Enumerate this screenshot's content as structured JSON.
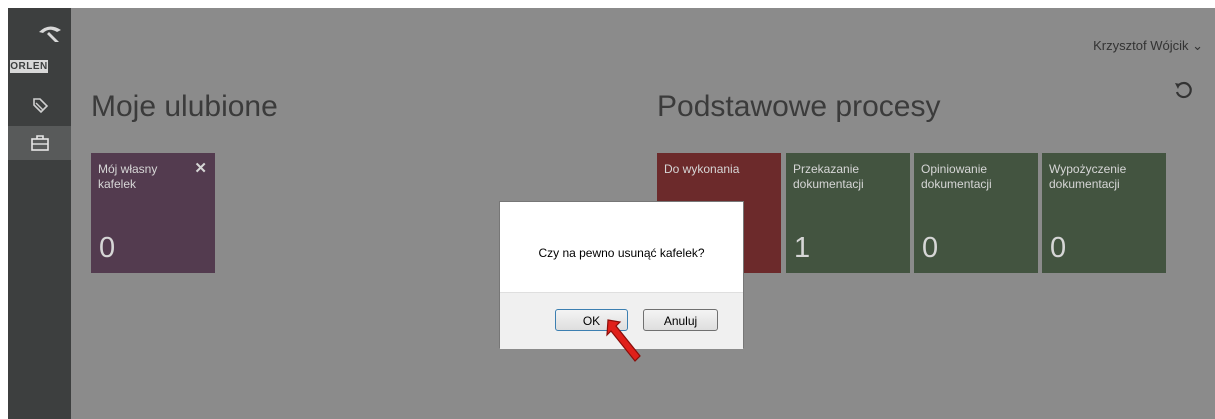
{
  "sidebar": {
    "logo_text": "ORLEN",
    "items": [
      {
        "name": "documents",
        "icon": "tag-icon"
      },
      {
        "name": "processes",
        "icon": "briefcase-icon"
      }
    ]
  },
  "header": {
    "user_name": "Krzysztof Wójcik",
    "user_chevron": "⌄",
    "refresh_icon": "refresh-icon"
  },
  "favorites": {
    "title": "Moje ulubione",
    "tiles": [
      {
        "label": "Mój własny kafelek",
        "count": "0",
        "color": "#533b4f",
        "close": "✕"
      }
    ]
  },
  "processes": {
    "title": "Podstawowe procesy",
    "tiles": [
      {
        "label": "Do wykonania",
        "count": "",
        "color": "#6c2a2b"
      },
      {
        "label": "Przekazanie dokumentacji",
        "count": "1",
        "color": "#435440"
      },
      {
        "label": "Opiniowanie dokumentacji",
        "count": "0",
        "color": "#435440"
      },
      {
        "label": "Wypożyczenie dokumentacji",
        "count": "0",
        "color": "#435440"
      }
    ]
  },
  "dialog": {
    "message": "Czy na pewno usunąć kafelek?",
    "ok_label": "OK",
    "cancel_label": "Anuluj"
  }
}
